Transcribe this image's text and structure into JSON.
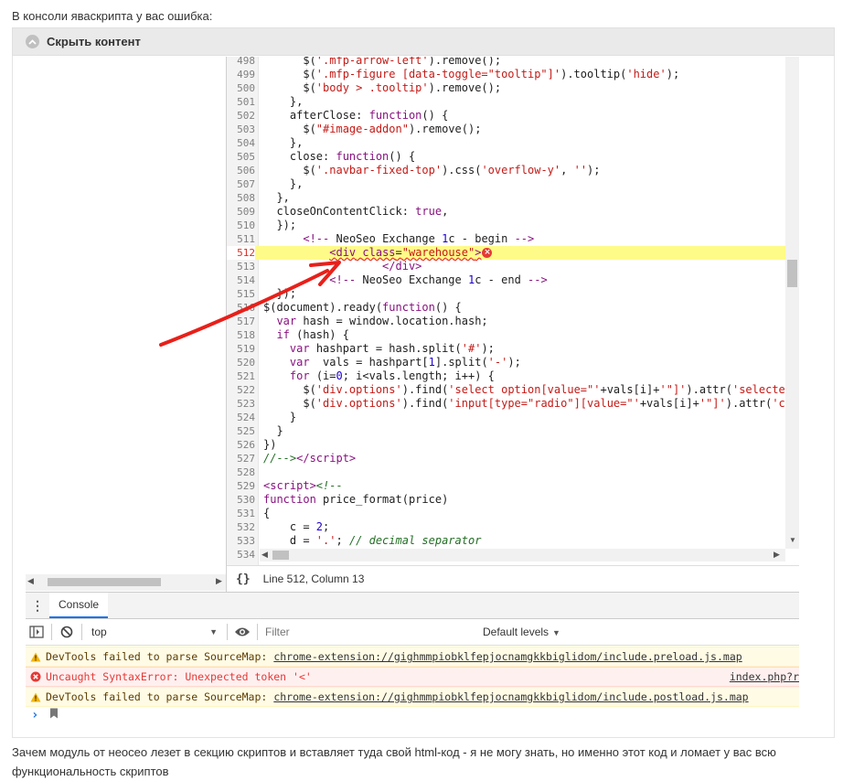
{
  "intro_text": "В консоли яваскрипта у вас ошибка:",
  "spoiler": {
    "label": "Скрыть контент"
  },
  "code_lines": [
    {
      "n": "498",
      "html": "      $(<span class=\"str\">'.mfp-arrow-left'</span>).remove();"
    },
    {
      "n": "499",
      "html": "      $(<span class=\"str\">'.mfp-figure [data-toggle=\"tooltip\"]'</span>).tooltip(<span class=\"str\">'hide'</span>);"
    },
    {
      "n": "500",
      "html": "      $(<span class=\"str\">'body &gt; .tooltip'</span>).remove();"
    },
    {
      "n": "501",
      "html": "    },"
    },
    {
      "n": "502",
      "html": "    afterClose: <span class=\"kw\">function</span>() {"
    },
    {
      "n": "503",
      "html": "      $(<span class=\"str\">\"#image-addon\"</span>).remove();"
    },
    {
      "n": "504",
      "html": "    },"
    },
    {
      "n": "505",
      "html": "    close: <span class=\"kw\">function</span>() {"
    },
    {
      "n": "506",
      "html": "      $(<span class=\"str\">'.navbar-fixed-top'</span>).css(<span class=\"str\">'overflow-y'</span>, <span class=\"str\">''</span>);"
    },
    {
      "n": "507",
      "html": "    },"
    },
    {
      "n": "508",
      "html": "  },"
    },
    {
      "n": "509",
      "html": "  closeOnContentClick: <span class=\"kw\">true</span>,"
    },
    {
      "n": "510",
      "html": "  });"
    },
    {
      "n": "511",
      "html": "      <span class=\"tag\">&lt;!--</span> NeoSeo Exchange <span class=\"num\">1</span>c - begin <span class=\"tag\">--&gt;</span>"
    },
    {
      "n": "512",
      "html": "          <span class=\"squiggle\"><span class=\"tag\">&lt;div</span> <span class=\"tag\">class</span>=<span class=\"str\">\"warehouse\"</span><span class=\"tag\">&gt;</span></span><span class=\"err-mark\">×</span>",
      "hl": true
    },
    {
      "n": "513",
      "html": "                  <span class=\"tag\">&lt;/div&gt;</span>"
    },
    {
      "n": "514",
      "html": "          <span class=\"tag\">&lt;!--</span> NeoSeo Exchange <span class=\"num\">1</span>c - end <span class=\"tag\">--&gt;</span>"
    },
    {
      "n": "515",
      "html": "  });"
    },
    {
      "n": "516",
      "html": "$(document).ready(<span class=\"kw\">function</span>() {"
    },
    {
      "n": "517",
      "html": "  <span class=\"kw\">var</span> hash = window.location.hash;"
    },
    {
      "n": "518",
      "html": "  <span class=\"kw\">if</span> (hash) {"
    },
    {
      "n": "519",
      "html": "    <span class=\"kw\">var</span> hashpart = hash.split(<span class=\"str\">'#'</span>);"
    },
    {
      "n": "520",
      "html": "    <span class=\"kw\">var</span>  vals = hashpart[<span class=\"num\">1</span>].split(<span class=\"str\">'-'</span>);"
    },
    {
      "n": "521",
      "html": "    <span class=\"kw\">for</span> (i=<span class=\"num\">0</span>; i&lt;vals.length; i++) {"
    },
    {
      "n": "522",
      "html": "      $(<span class=\"str\">'div.options'</span>).find(<span class=\"str\">'select option[value=\"'</span>+vals[i]+<span class=\"str\">'\"]'</span>).attr(<span class=\"str\">'selecte</span>"
    },
    {
      "n": "523",
      "html": "      $(<span class=\"str\">'div.options'</span>).find(<span class=\"str\">'input[type=\"radio\"][value=\"'</span>+vals[i]+<span class=\"str\">'\"]'</span>).attr(<span class=\"str\">'c</span>"
    },
    {
      "n": "524",
      "html": "    }"
    },
    {
      "n": "525",
      "html": "  }"
    },
    {
      "n": "526",
      "html": "})"
    },
    {
      "n": "527",
      "html": "<span class=\"cm\">//--&gt;</span><span class=\"tag\">&lt;/script&gt;</span>"
    },
    {
      "n": "528",
      "html": ""
    },
    {
      "n": "529",
      "html": "<span class=\"tag\">&lt;script&gt;</span><span class=\"cm\">&lt;!--</span>"
    },
    {
      "n": "530",
      "html": "<span class=\"kw\">function</span> price_format(price)"
    },
    {
      "n": "531",
      "html": "{"
    },
    {
      "n": "532",
      "html": "    c = <span class=\"num\">2</span>;"
    },
    {
      "n": "533",
      "html": "    d = <span class=\"str\">'.'</span>; <span class=\"cm\">// decimal separator</span>"
    },
    {
      "n": "534",
      "html": ""
    }
  ],
  "statusbar": {
    "braces": "{}",
    "position": "Line 512, Column 13"
  },
  "console": {
    "tab_label": "Console",
    "context": "top",
    "filter_placeholder": "Filter",
    "levels_label": "Default levels",
    "messages": [
      {
        "type": "warn",
        "text": "DevTools failed to parse SourceMap:",
        "link": "chrome-extension://gighmmpiobklfepjocnamgkkbiglidom/include.preload.js.map",
        "src": ""
      },
      {
        "type": "err",
        "text": "Uncaught SyntaxError: Unexpected token '<'",
        "link": "",
        "src": "index.php?r"
      },
      {
        "type": "warn",
        "text": "DevTools failed to parse SourceMap:",
        "link": "chrome-extension://gighmmpiobklfepjocnamgkkbiglidom/include.postload.js.map",
        "src": ""
      }
    ],
    "prompt_symbol": "›"
  },
  "outro_text": "Зачем модуль от неосео лезет в секцию скриптов и вставляет туда свой html-код - я не могу знать, но именно этот код и ломает у вас всю функциональность скриптов",
  "colors": {
    "highlight": "#fefb88",
    "error": "#e53935",
    "arrow": "#e8201a",
    "warn_bg": "#fffbe5",
    "err_bg": "#fff0f0"
  }
}
